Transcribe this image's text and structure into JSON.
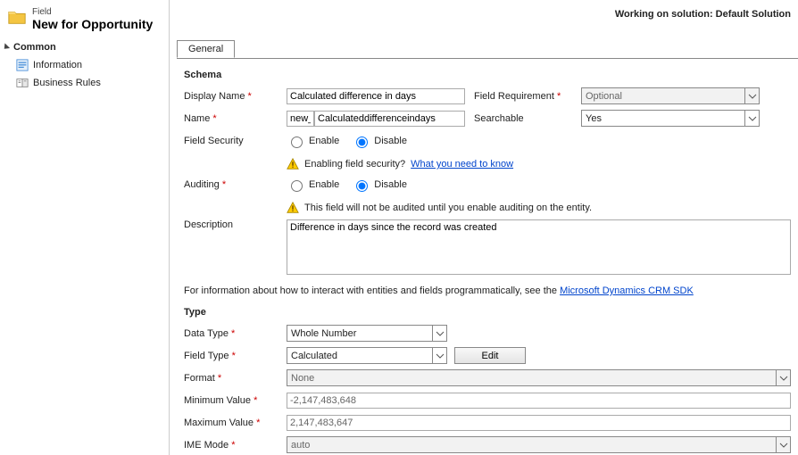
{
  "header": {
    "super": "Field",
    "title": "New for Opportunity"
  },
  "topRight": "Working on solution: Default Solution",
  "sidebar": {
    "section": "Common",
    "items": [
      {
        "label": "Information"
      },
      {
        "label": "Business Rules"
      }
    ]
  },
  "tabs": {
    "general": "General"
  },
  "schema": {
    "heading": "Schema",
    "displayNameLabel": "Display Name",
    "displayNameValue": "Calculated difference in days",
    "fieldReqLabel": "Field Requirement",
    "fieldReqValue": "Optional",
    "nameLabel": "Name",
    "namePrefix": "new_",
    "nameValue": "Calculateddifferenceindays",
    "searchableLabel": "Searchable",
    "searchableValue": "Yes",
    "fieldSecurityLabel": "Field Security",
    "enable": "Enable",
    "disable": "Disable",
    "securityWarn": "Enabling field security?",
    "securityLink": "What you need to know",
    "auditingLabel": "Auditing",
    "auditingWarn": "This field will not be audited until you enable auditing on the entity.",
    "descriptionLabel": "Description",
    "descriptionValue": "Difference in days since the record was created"
  },
  "infoPara": {
    "text": "For information about how to interact with entities and fields programmatically, see the ",
    "link": "Microsoft Dynamics CRM SDK"
  },
  "type": {
    "heading": "Type",
    "dataTypeLabel": "Data Type",
    "dataTypeValue": "Whole Number",
    "fieldTypeLabel": "Field Type",
    "fieldTypeValue": "Calculated",
    "editBtn": "Edit",
    "formatLabel": "Format",
    "formatValue": "None",
    "minLabel": "Minimum Value",
    "minValue": "-2,147,483,648",
    "maxLabel": "Maximum Value",
    "maxValue": "2,147,483,647",
    "imeLabel": "IME Mode",
    "imeValue": "auto"
  }
}
